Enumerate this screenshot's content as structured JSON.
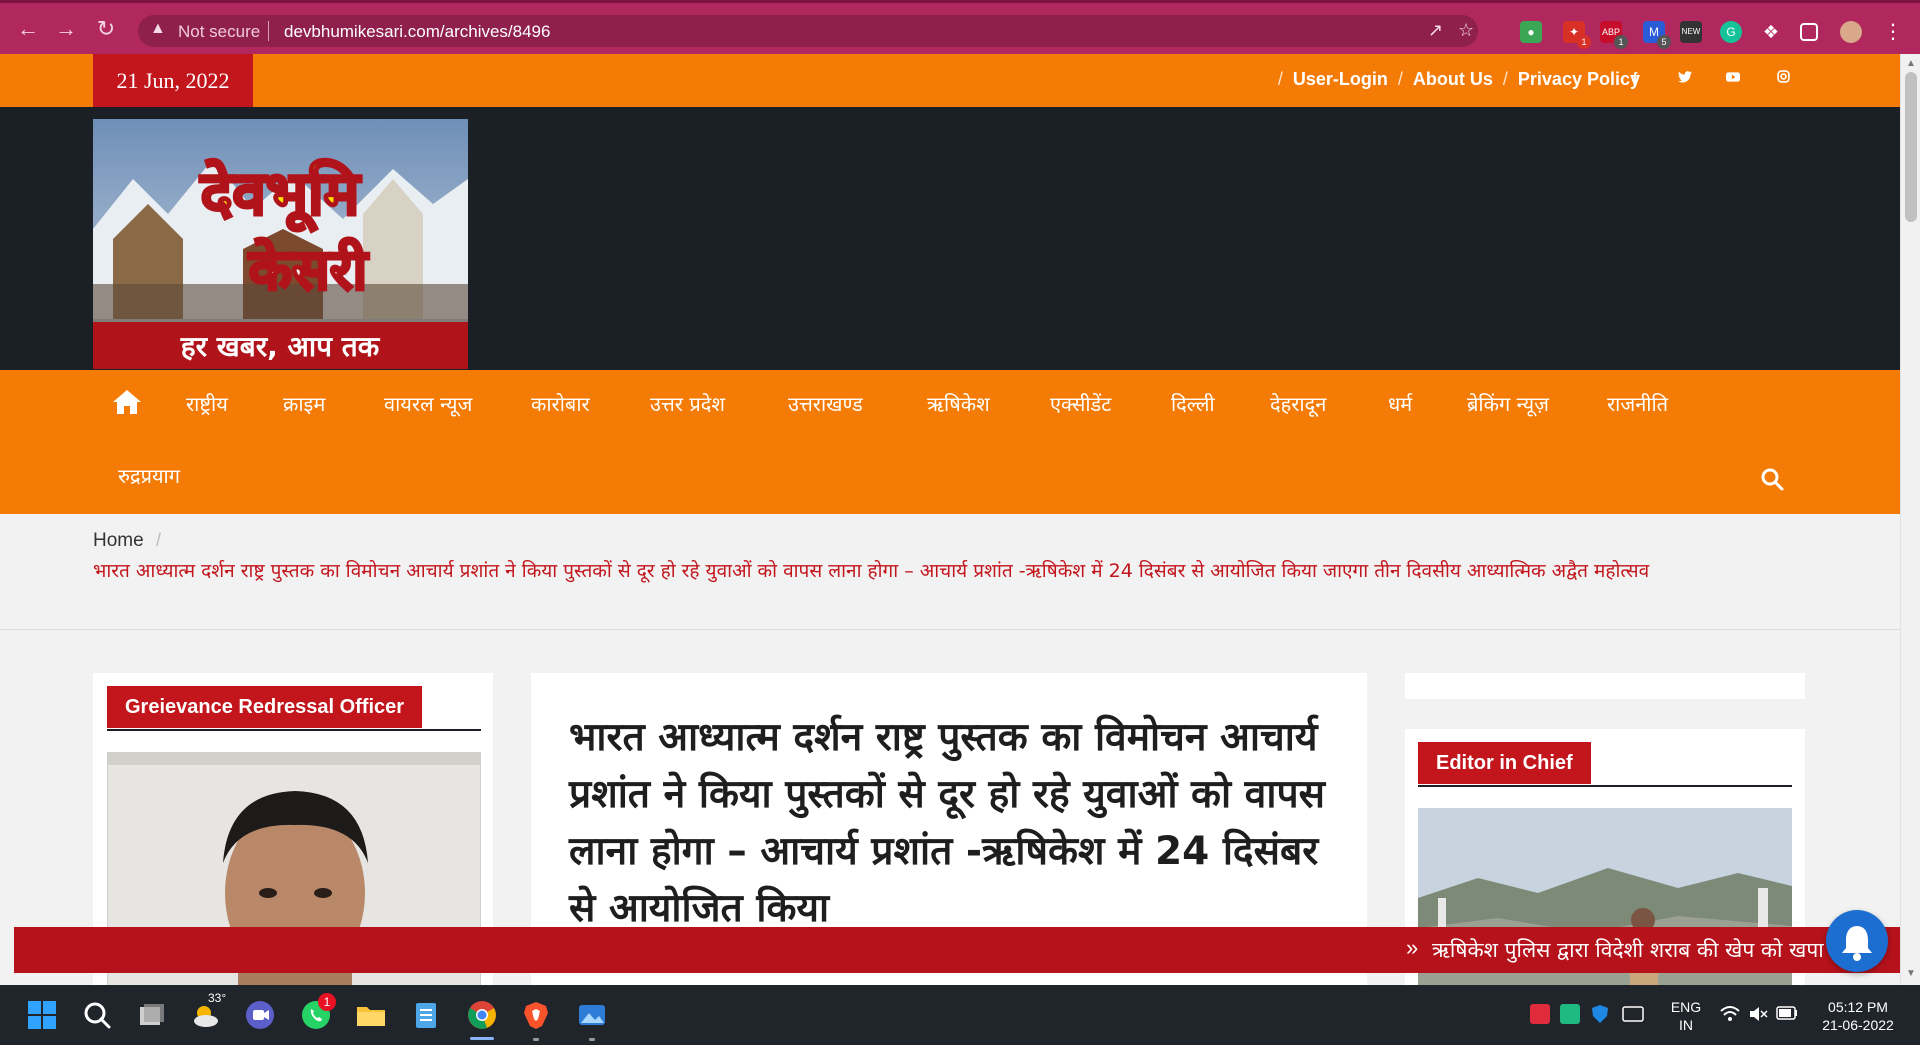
{
  "browser": {
    "url_warning": "Not secure",
    "url": "devbhumikesari.com/archives/8496",
    "extensions": [
      {
        "name": "rainbow-extension-icon",
        "color": "#3aa757"
      },
      {
        "name": "red-extension-icon",
        "color": "#d93025",
        "badge": "1"
      },
      {
        "name": "abp-extension-icon",
        "color": "#c70d2c",
        "badge": "1"
      },
      {
        "name": "blue-extension-icon",
        "color": "#2b5cd8",
        "badge": "5"
      },
      {
        "name": "new-extension-icon",
        "color": "#333333",
        "badge": ""
      },
      {
        "name": "grammarly-extension-icon",
        "color": "#15c39a",
        "badge": ""
      }
    ]
  },
  "topbar": {
    "date": "21 Jun, 2022",
    "links": [
      "User-Login",
      "About Us",
      "Privacy Policy"
    ],
    "social": [
      "facebook-icon",
      "twitter-icon",
      "youtube-icon",
      "instagram-icon"
    ]
  },
  "logo": {
    "line1": "देवभूमि",
    "line2": "केसरी",
    "tagline": "हर खबर, आप तक"
  },
  "nav": {
    "items": [
      "राष्ट्रीय",
      "क्राइम",
      "वायरल न्यूज",
      "कारोबार",
      "उत्तर प्रदेश",
      "उत्तराखण्ड",
      "ऋषिकेश",
      "एक्सीडेंट",
      "दिल्ली",
      "देहरादून",
      "धर्म",
      "ब्रेकिंग न्यूज़",
      "राजनीति",
      "रुद्रप्रयाग"
    ]
  },
  "breadcrumb": {
    "home": "Home",
    "separator": "/",
    "current": "भारत आध्यात्म दर्शन राष्ट्र पुस्तक का विमोचन आचार्य प्रशांत ने किया पुस्तकों से दूर हो रहे युवाओं को वापस लाना होगा – आचार्य प्रशांत -ऋषिकेश में 24 दिसंबर से आयोजित किया जाएगा तीन दिवसीय आध्यात्मिक अद्वैत महोत्सव"
  },
  "sidebar_left": {
    "title": "Greievance Redressal Officer"
  },
  "article": {
    "title": "भारत आध्यात्म दर्शन राष्ट्र पुस्तक का विमोचन आचार्य प्रशांत ने किया पुस्तकों से दूर हो रहे युवाओं को वापस लाना होगा – आचार्य प्रशांत -ऋषिकेश में 24 दिसंबर से आयोजित किया"
  },
  "sidebar_right": {
    "title": "Editor in Chief"
  },
  "ticker": {
    "arrows": "»",
    "text": "ऋषिकेश पुलिस द्वारा विदेशी शराब की खेप को खपा"
  },
  "taskbar": {
    "weather_temp": "33°",
    "whatsapp_badge": "1",
    "lang_line1": "ENG",
    "lang_line2": "IN",
    "time": "05:12 PM",
    "date": "21-06-2022"
  },
  "colors": {
    "orange": "#f47b06",
    "red": "#c2151c",
    "dark": "#1b1f26",
    "chrome": "#b1285f"
  }
}
